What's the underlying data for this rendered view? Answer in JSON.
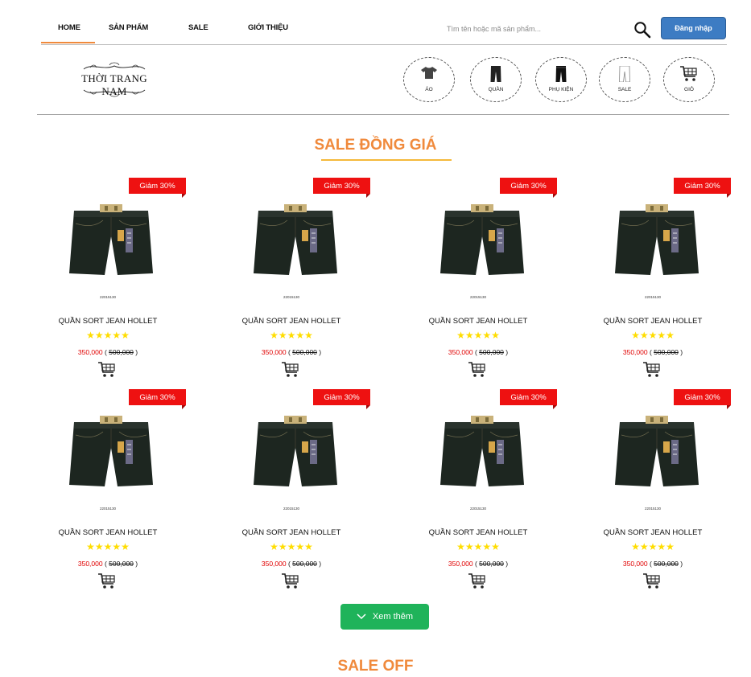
{
  "nav": {
    "items": [
      {
        "label": "HOME",
        "active": true
      },
      {
        "label": "SẢN PHẨM"
      },
      {
        "label": "SALE"
      },
      {
        "label": "GIỚI THIỆU"
      }
    ],
    "search_placeholder": "Tìm tên hoặc mã sản phẩm...",
    "login_label": "Đăng nhập"
  },
  "logo": {
    "text": "THỜI TRANG NAM"
  },
  "categories": [
    {
      "label": "ÁO",
      "icon": "shirt-icon"
    },
    {
      "label": "QUẦN",
      "icon": "pants-icon"
    },
    {
      "label": "PHỤ KIỆN",
      "icon": "accessory-pants-icon"
    },
    {
      "label": "SALE",
      "icon": "sale-pants-icon"
    },
    {
      "label": "GIỎ",
      "icon": "cart-icon"
    }
  ],
  "section1": {
    "title": "SALE ĐỒNG GIÁ"
  },
  "products": [
    {
      "badge": "Giảm 30%",
      "name": "QUẦN SORT JEAN HOLLET",
      "stars": "★★★★★",
      "price": "350,000",
      "old_price": "500,000",
      "sku": "22015130"
    },
    {
      "badge": "Giảm 30%",
      "name": "QUẦN SORT JEAN HOLLET",
      "stars": "★★★★★",
      "price": "350,000",
      "old_price": "500,000",
      "sku": "22015130"
    },
    {
      "badge": "Giảm 30%",
      "name": "QUẦN SORT JEAN HOLLET",
      "stars": "★★★★★",
      "price": "350,000",
      "old_price": "500,000",
      "sku": "22015130"
    },
    {
      "badge": "Giảm 30%",
      "name": "QUẦN SORT JEAN HOLLET",
      "stars": "★★★★★",
      "price": "350,000",
      "old_price": "500,000",
      "sku": "22015130"
    },
    {
      "badge": "Giảm 30%",
      "name": "QUẦN SORT JEAN HOLLET",
      "stars": "★★★★★",
      "price": "350,000",
      "old_price": "500,000",
      "sku": "22015130"
    },
    {
      "badge": "Giảm 30%",
      "name": "QUẦN SORT JEAN HOLLET",
      "stars": "★★★★★",
      "price": "350,000",
      "old_price": "500,000",
      "sku": "22015130"
    },
    {
      "badge": "Giảm 30%",
      "name": "QUẦN SORT JEAN HOLLET",
      "stars": "★★★★★",
      "price": "350,000",
      "old_price": "500,000",
      "sku": "22015130"
    },
    {
      "badge": "Giảm 30%",
      "name": "QUẦN SORT JEAN HOLLET",
      "stars": "★★★★★",
      "price": "350,000",
      "old_price": "500,000",
      "sku": "22015130"
    }
  ],
  "more_button": {
    "label": "Xem thêm"
  },
  "section2": {
    "title": "SALE OFF"
  },
  "colors": {
    "accent": "#f08a3c",
    "badge": "#ee1111",
    "login": "#3d7cc3",
    "more": "#1fb35a",
    "price": "#e00000",
    "stars": "#ffdd00"
  }
}
